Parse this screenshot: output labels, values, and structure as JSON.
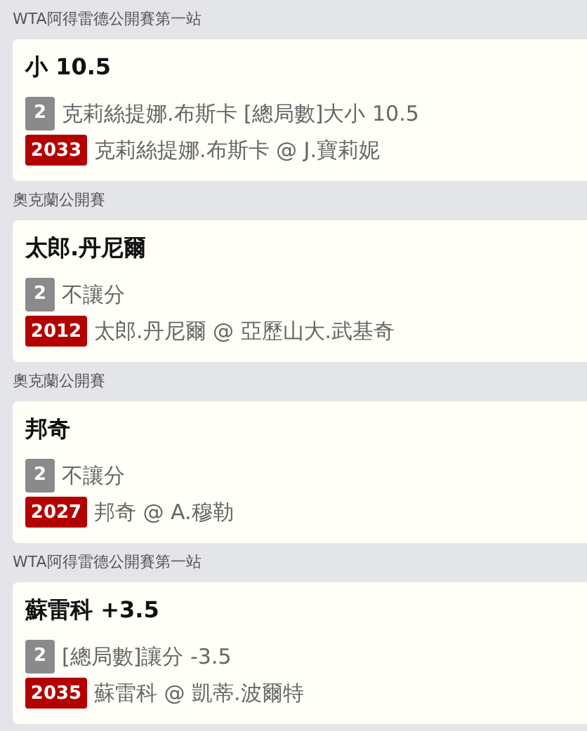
{
  "bets": [
    {
      "league": "WTA阿得雷德公開賽第一站",
      "selection": "小 10.5",
      "odds_badge": "2",
      "market": "克莉絲提娜.布斯卡 [總局數]大小 10.5",
      "match_code": "2033",
      "match": "克莉絲提娜.布斯卡 @ J.寶莉妮"
    },
    {
      "league": "奧克蘭公開賽",
      "selection": "太郎.丹尼爾",
      "odds_badge": "2",
      "market": "不讓分",
      "match_code": "2012",
      "match": "太郎.丹尼爾 @ 亞歷山大.武基奇"
    },
    {
      "league": "奧克蘭公開賽",
      "selection": "邦奇",
      "odds_badge": "2",
      "market": "不讓分",
      "match_code": "2027",
      "match": "邦奇 @ A.穆勒"
    },
    {
      "league": "WTA阿得雷德公開賽第一站",
      "selection": "蘇雷科 +3.5",
      "odds_badge": "2",
      "market": "[總局數]讓分 -3.5",
      "match_code": "2035",
      "match": "蘇雷科 @ 凱蒂.波爾特"
    }
  ]
}
